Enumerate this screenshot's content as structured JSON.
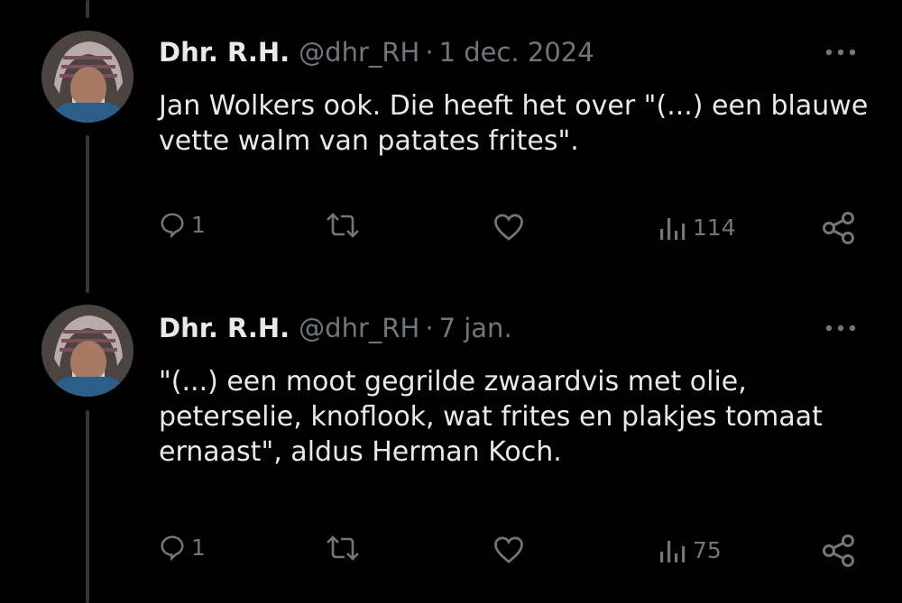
{
  "tweets": [
    {
      "name": "Dhr. R.H.",
      "handle": "@dhr_RH",
      "separator": "·",
      "date": "1 dec. 2024",
      "text": "Jan Wolkers ook. Die heeft het over \"(...) een blauwe vette walm van patates frites\".",
      "replies": "1",
      "views": "114",
      "avatar": "profile-photo",
      "more_icon": "more-horizontal-icon"
    },
    {
      "name": "Dhr. R.H.",
      "handle": "@dhr_RH",
      "separator": "·",
      "date": "7 jan.",
      "text": "\"(...) een moot gegrilde zwaardvis met olie, peterselie, knoflook, wat frites en plakjes tomaat ernaast\", aldus Herman Koch.",
      "replies": "1",
      "views": "75",
      "avatar": "profile-photo",
      "more_icon": "more-horizontal-icon"
    }
  ],
  "actions": {
    "reply_icon": "reply-icon",
    "retweet_icon": "retweet-icon",
    "like_icon": "heart-icon",
    "views_icon": "analytics-icon",
    "share_icon": "share-icon"
  },
  "colors": {
    "background": "#000000",
    "text_primary": "#e7e9ea",
    "text_secondary": "#71767b",
    "thread_line": "#333639"
  }
}
